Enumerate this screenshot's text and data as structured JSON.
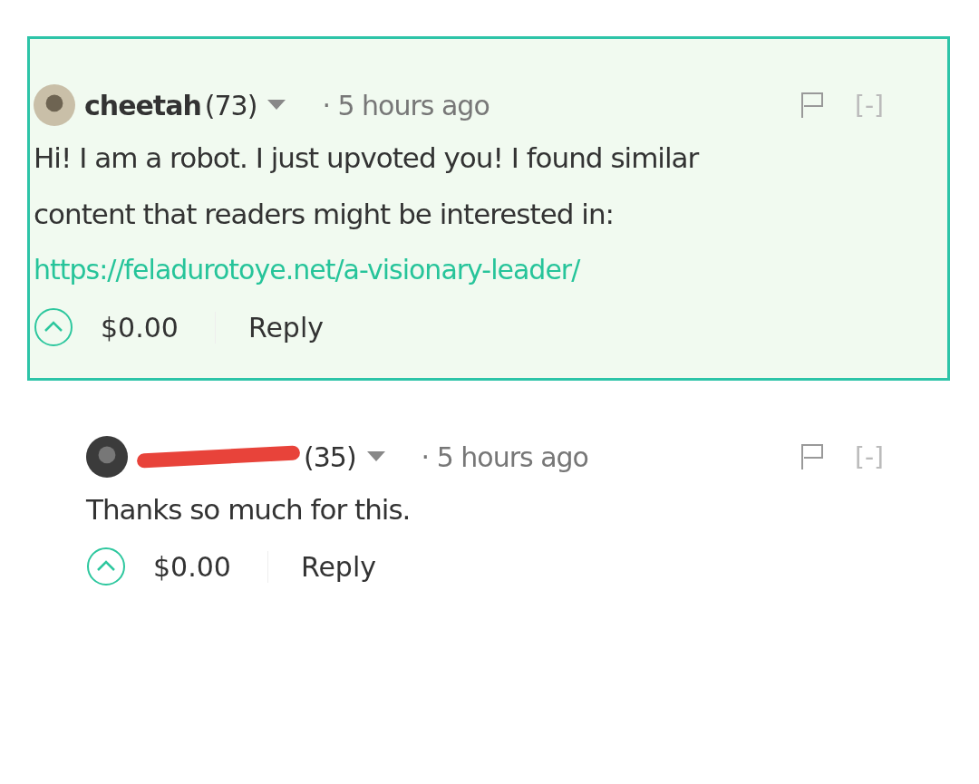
{
  "comments": [
    {
      "author": "cheetah",
      "author_redacted": false,
      "reputation": "(73)",
      "time": "· 5 hours ago",
      "highlighted": true,
      "body": "Hi! I am a robot. I just upvoted you! I found similar content that readers might be interested in:",
      "link": "https://feladurotoye.net/a-visionary-leader/",
      "collapse": "[-]",
      "payout": "$0.00",
      "reply": "Reply",
      "children": [
        {
          "author_redacted": true,
          "reputation": "(35)",
          "time": "· 5 hours ago",
          "highlighted": false,
          "body": "Thanks so much for this.",
          "collapse": "[-]",
          "payout": "$0.00",
          "reply": "Reply"
        }
      ]
    }
  ]
}
